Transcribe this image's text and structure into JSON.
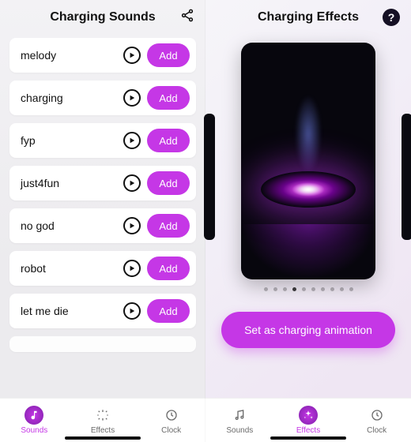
{
  "accent": "#c537e6",
  "left": {
    "header": {
      "title": "Charging Sounds"
    },
    "sounds": [
      {
        "name": "melody",
        "add_label": "Add"
      },
      {
        "name": "charging",
        "add_label": "Add"
      },
      {
        "name": "fyp",
        "add_label": "Add"
      },
      {
        "name": "just4fun",
        "add_label": "Add"
      },
      {
        "name": "no god",
        "add_label": "Add"
      },
      {
        "name": "robot",
        "add_label": "Add"
      },
      {
        "name": "let me die",
        "add_label": "Add"
      }
    ],
    "tabs": {
      "items": [
        {
          "label": "Sounds",
          "active": true
        },
        {
          "label": "Effects",
          "active": false
        },
        {
          "label": "Clock",
          "active": false
        }
      ]
    }
  },
  "right": {
    "header": {
      "title": "Charging Effects",
      "help": "?"
    },
    "pager": {
      "count": 10,
      "index": 3
    },
    "cta_label": "Set as charging animation",
    "tabs": {
      "items": [
        {
          "label": "Sounds",
          "active": false
        },
        {
          "label": "Effects",
          "active": true
        },
        {
          "label": "Clock",
          "active": false
        }
      ]
    }
  }
}
